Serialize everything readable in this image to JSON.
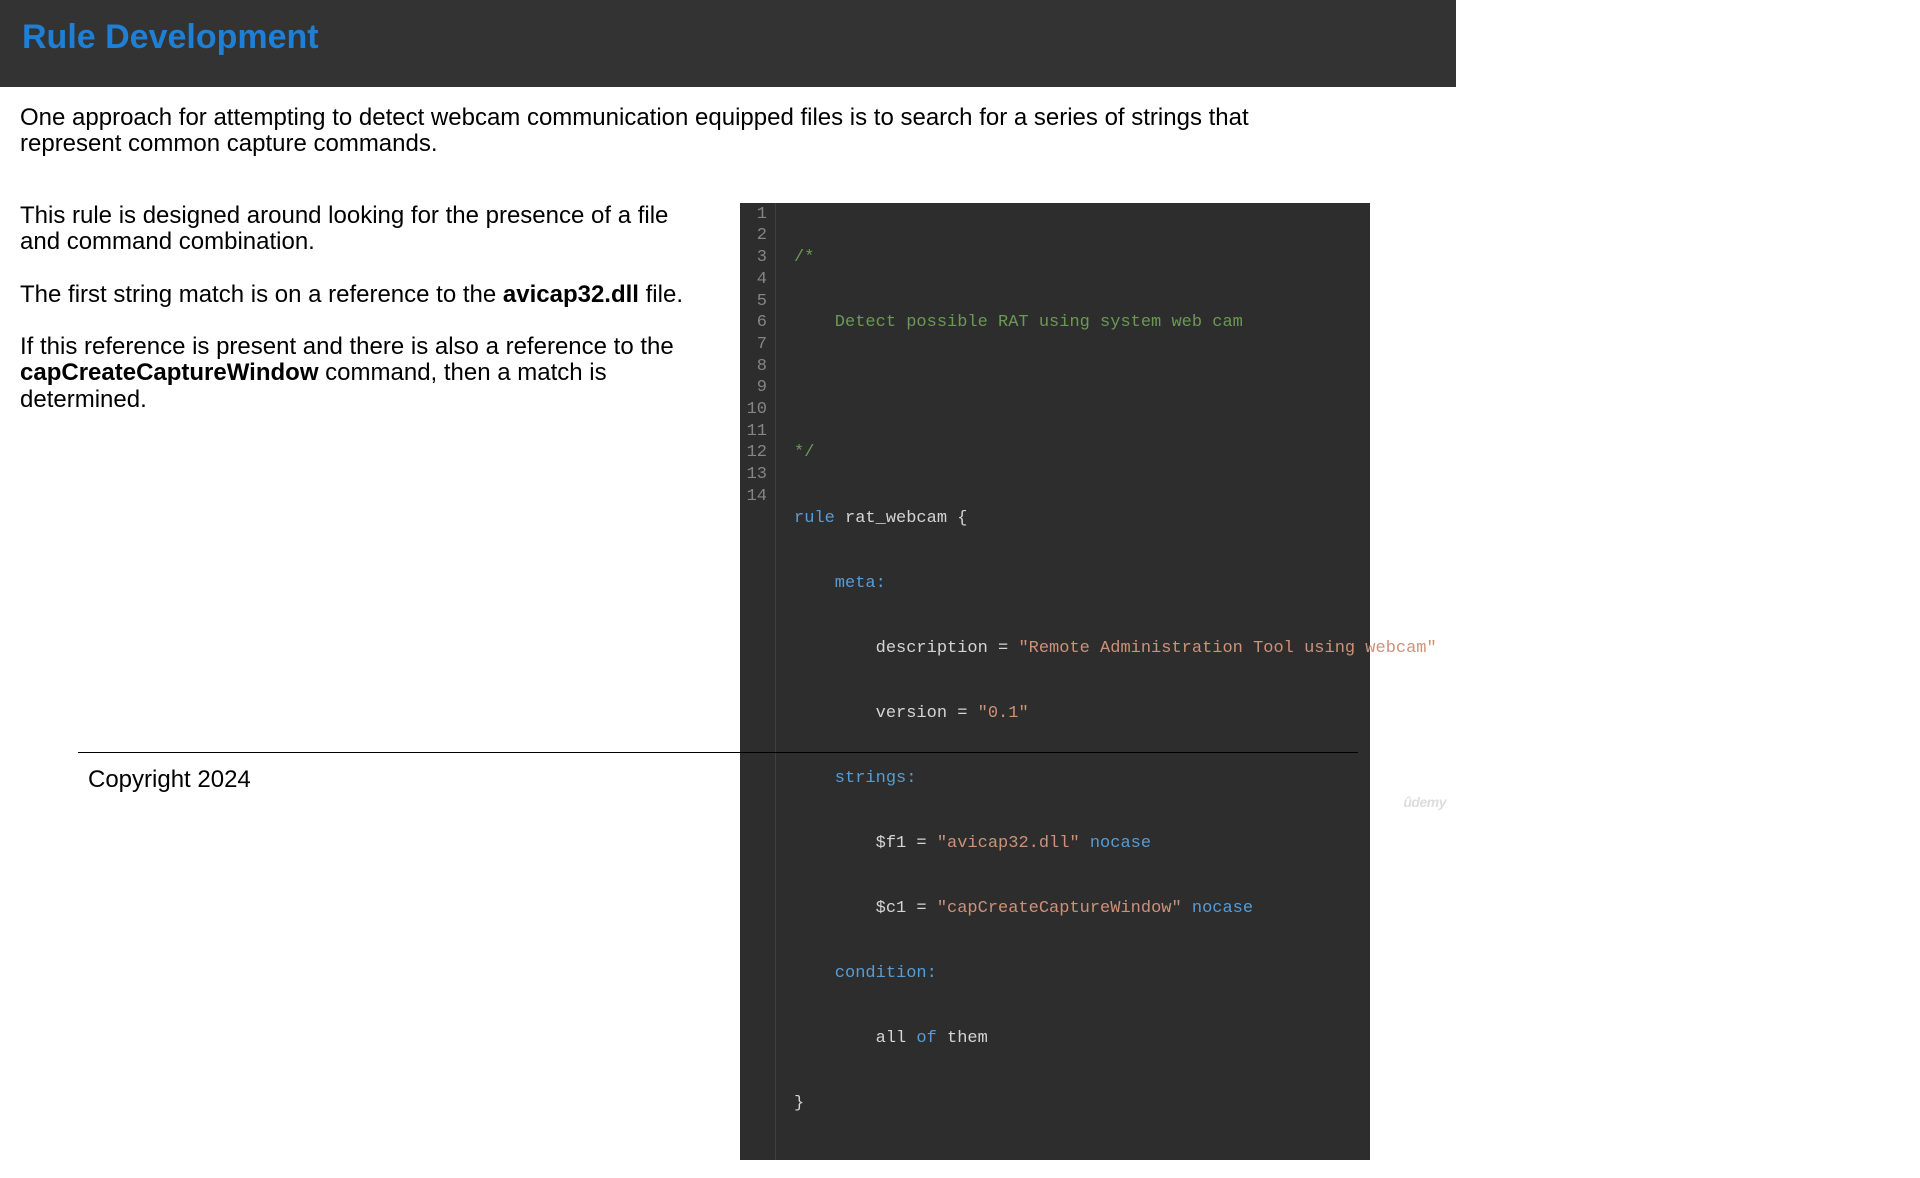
{
  "header": {
    "title": "Rule Development"
  },
  "intro": "One approach for attempting to detect webcam communication equipped files is to search for a series of strings that represent common capture commands.",
  "left": {
    "p1": "This rule is designed around looking for the presence of a file and command combination.",
    "p2_pre": "The first string match is on a reference to the ",
    "p2_bold": "avicap32.dll",
    "p2_post": " file.",
    "p3_pre": "If this reference is present and there is also a reference to the ",
    "p3_bold": "capCreateCaptureWindow",
    "p3_post": " command, then a match is determined."
  },
  "code": {
    "line_numbers": [
      "1",
      "2",
      "3",
      "4",
      "5",
      "6",
      "7",
      "8",
      "9",
      "10",
      "11",
      "12",
      "13",
      "14"
    ],
    "l1": "/*",
    "l2": "    Detect possible RAT using system web cam",
    "l3": "",
    "l4": "*/",
    "l5_kw": "rule",
    "l5_name": " rat_webcam ",
    "l5_brace": "{",
    "l6": "    meta:",
    "l7_indent": "        description = ",
    "l7_str": "\"Remote Administration Tool using webcam\"",
    "l8_indent": "        version = ",
    "l8_str": "\"0.1\"",
    "l9": "    strings:",
    "l10_indent": "        $f1 = ",
    "l10_str": "\"avicap32.dll\"",
    "l10_mod": " nocase",
    "l11_indent": "        $c1 = ",
    "l11_str": "\"capCreateCaptureWindow\"",
    "l11_mod": " nocase",
    "l12": "    condition:",
    "l13_indent": "        all ",
    "l13_kw": "of",
    "l13_post": " them",
    "l14": "}"
  },
  "footer": {
    "copyright": "Copyright 2024"
  },
  "watermark": "ûdemy"
}
